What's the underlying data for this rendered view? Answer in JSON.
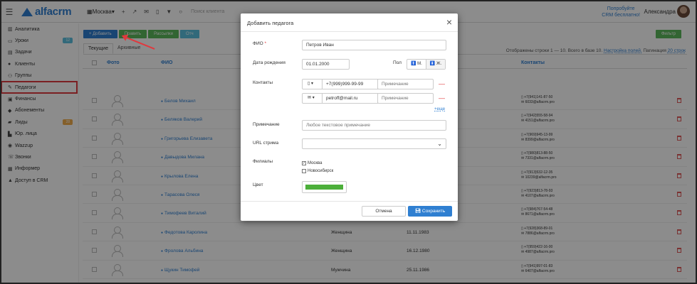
{
  "topbar": {
    "logo": "alfacrm",
    "branch": "Москва",
    "search_placeholder": "Поиск клиента",
    "trial_line1": "Попробуйте",
    "trial_line2": "CRM бесплатно!",
    "user_name": "Александра"
  },
  "sidebar": {
    "items": [
      {
        "label": "Аналитика",
        "icon": "chart-icon"
      },
      {
        "label": "Уроки",
        "icon": "calendar-icon",
        "badge": "12",
        "badge_color": "#5bc0de"
      },
      {
        "label": "Задачи",
        "icon": "tasks-icon"
      },
      {
        "label": "Клиенты",
        "icon": "user-icon"
      },
      {
        "label": "Группы",
        "icon": "group-icon"
      },
      {
        "label": "Педагоги",
        "icon": "teacher-icon"
      },
      {
        "label": "Финансы",
        "icon": "money-icon"
      },
      {
        "label": "Абонементы",
        "icon": "tag-icon"
      },
      {
        "label": "Лиды",
        "icon": "funnel-icon",
        "badge": "28",
        "badge_color": "#f0ad4e"
      },
      {
        "label": "Юр. лица",
        "icon": "building-icon"
      },
      {
        "label": "Wazzup",
        "icon": "chat-icon"
      },
      {
        "label": "Звонки",
        "icon": "phone-icon"
      },
      {
        "label": "Информер",
        "icon": "informer-icon"
      },
      {
        "label": "Доступ в CRM",
        "icon": "lock-icon"
      }
    ]
  },
  "toolbar": {
    "add": "+ Добавить",
    "edit": "Править",
    "mailing": "Рассылки",
    "other": "Отч",
    "filter": "Фильтр"
  },
  "tabs": [
    "Текущие",
    "Архивные"
  ],
  "stats": {
    "shown": "Отображены строки 1 — 10. Всего в базе 10.",
    "settings_link": "Настройка полей.",
    "pagination": "Пагинация",
    "rows_link": "20 строк"
  },
  "table": {
    "headers": {
      "photo": "Фото",
      "name": "ФИО",
      "contacts": "Контакты"
    },
    "rows": [
      {
        "name": "Белов Михаил",
        "gender": "",
        "dob": "",
        "phone": "+7(941)141-87-50",
        "email": "6033@alfacrm.pro"
      },
      {
        "name": "Беляков Валерий",
        "gender": "",
        "dob": "",
        "phone": "+7(942)555-58-94",
        "email": "4151@alfacrm.pro"
      },
      {
        "name": "Григорьева Елизавета",
        "gender": "",
        "dob": "",
        "phone": "+7(969)945-13-99",
        "email": "8399@alfacrm.pro"
      },
      {
        "name": "Давыдова Милана",
        "gender": "",
        "dob": "",
        "phone": "+7(980)813-88-50",
        "email": "7331@alfacrm.pro"
      },
      {
        "name": "Крылова Елена",
        "gender": "",
        "dob": "",
        "phone": "+7(913)532-12-35",
        "email": "10239@alfacrm.pro"
      },
      {
        "name": "Тарасова Олеся",
        "gender": "",
        "dob": "",
        "phone": "+7(923)813-78-93",
        "email": "4107@alfacrm.pro"
      },
      {
        "name": "Тимофеев Виталий",
        "gender": "",
        "dob": "",
        "phone": "+7(984)767-54-48",
        "email": "8671@alfacrm.pro"
      },
      {
        "name": "Федотова Каролина",
        "gender": "Женщина",
        "dob": "11.11.1983",
        "phone": "+7(928)368-89-01",
        "email": "7886@alfacrm.pro"
      },
      {
        "name": "Фролова Альбина",
        "gender": "Женщина",
        "dob": "16.12.1980",
        "phone": "+7(959)422-16-00",
        "email": "4987@alfacrm.pro"
      },
      {
        "name": "Щукин Тимофей",
        "gender": "Мужчина",
        "dob": "25.11.1986",
        "phone": "+7(941)997-01-83",
        "email": "6407@alfacrm.pro"
      }
    ]
  },
  "modal": {
    "title": "Добавить педагога",
    "fio_label": "ФИО",
    "fio_required": "*",
    "fio_value": "Петров Иван",
    "dob_label": "Дата рождения",
    "dob_value": "01.01.2000",
    "gender_label": "Пол",
    "gender_m": "М.",
    "gender_f": "Ж.",
    "contacts_label": "Контакты",
    "phone_value": "+7(999)999-99-99",
    "email_value": "petroff@mail.ru",
    "contact_note_placeholder": "Примечание",
    "more_link": "+еще",
    "note_label": "Примечание",
    "note_placeholder": "Любое текстовое примечание",
    "url_label": "URL стрима",
    "branches_label": "Филиалы",
    "branch_1": "Москва",
    "branch_2": "Новосибирск",
    "color_label": "Цвет",
    "color_value": "#4caf3a",
    "cancel": "Отмена",
    "save": "Сохранить"
  }
}
